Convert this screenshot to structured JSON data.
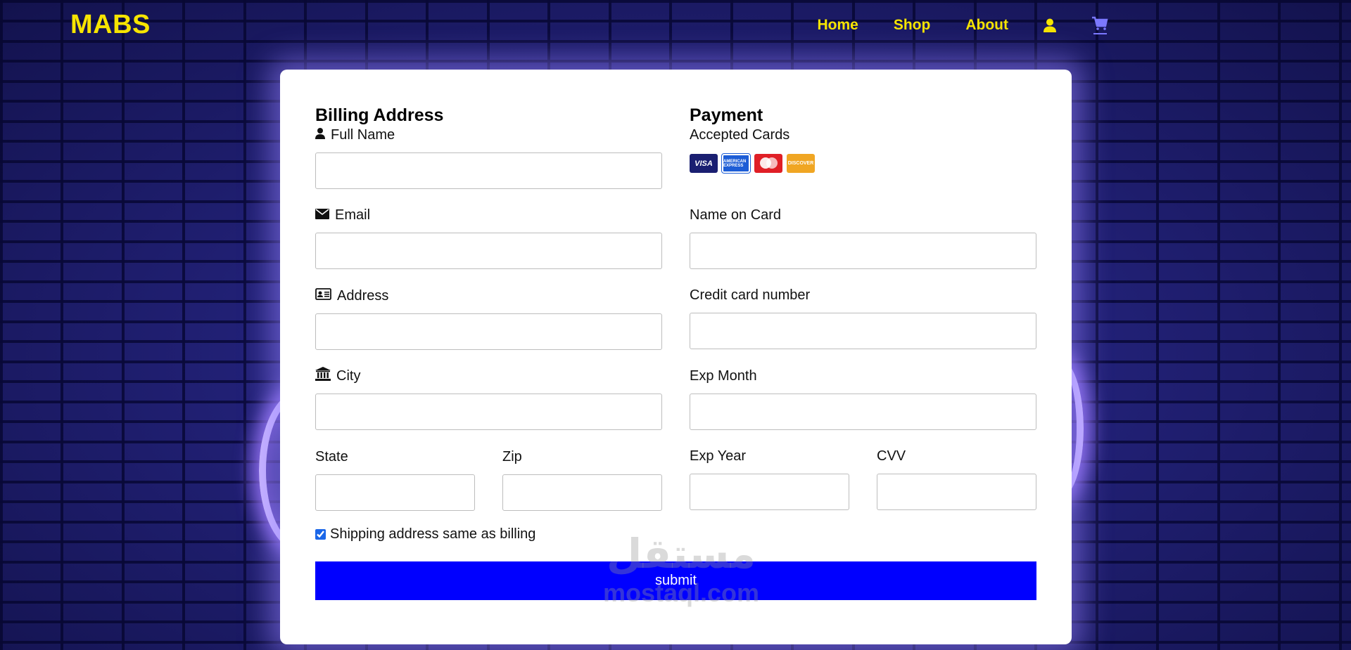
{
  "header": {
    "logo": "MABS",
    "nav": [
      {
        "label": "Home"
      },
      {
        "label": "Shop"
      },
      {
        "label": "About"
      }
    ],
    "icons": [
      "user-icon",
      "cart-icon"
    ]
  },
  "billing": {
    "title": "Billing Address",
    "full_name_label": "Full Name",
    "email_label": "Email",
    "address_label": "Address",
    "city_label": "City",
    "state_label": "State",
    "zip_label": "Zip"
  },
  "payment": {
    "title": "Payment",
    "accepted_cards_label": "Accepted Cards",
    "cards": [
      "VISA",
      "AMERICAN EXPRESS",
      "MasterCard",
      "DISCOVER"
    ],
    "name_on_card_label": "Name on Card",
    "card_number_label": "Credit card number",
    "exp_month_label": "Exp Month",
    "exp_year_label": "Exp Year",
    "cvv_label": "CVV"
  },
  "shipping_same": {
    "label": "Shipping address same as billing",
    "checked": true
  },
  "submit_label": "submit",
  "watermark": {
    "arabic": "مستقل",
    "latin": "mostaql.com"
  },
  "colors": {
    "accent_yellow": "#f6e400",
    "submit_blue": "#0000ff",
    "background": "#1e1d6e"
  }
}
